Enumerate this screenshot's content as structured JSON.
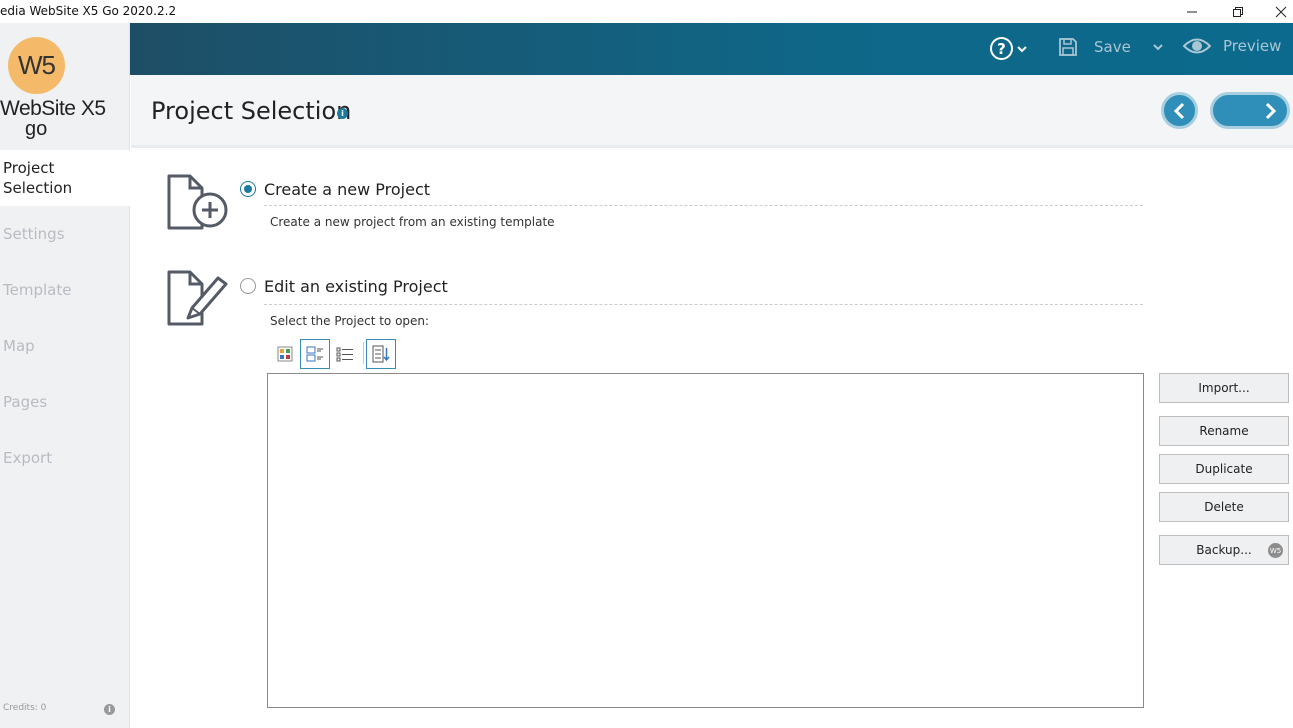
{
  "window": {
    "title": "edia WebSite X5 Go 2020.2.2"
  },
  "logo": {
    "mark": "W5",
    "name": "WebSite X5",
    "edition": "go"
  },
  "sidebar": {
    "items": [
      {
        "label": "Project Selection",
        "active": true
      },
      {
        "label": "Settings",
        "active": false
      },
      {
        "label": "Template",
        "active": false
      },
      {
        "label": "Map",
        "active": false
      },
      {
        "label": "Pages",
        "active": false
      },
      {
        "label": "Export",
        "active": false
      }
    ],
    "credits": "Credits: 0"
  },
  "toolbar": {
    "help_icon": "question-circle-icon",
    "save_label": "Save",
    "preview_label": "Preview"
  },
  "header": {
    "title": "Project Selection"
  },
  "main": {
    "create": {
      "label": "Create a new Project",
      "description": "Create a new project from an existing template",
      "selected": true
    },
    "edit": {
      "label": "Edit an existing Project",
      "prompt": "Select the Project to open:",
      "selected": false
    },
    "side_buttons": {
      "import": "Import...",
      "rename": "Rename",
      "duplicate": "Duplicate",
      "delete": "Delete",
      "backup": "Backup...",
      "backup_badge": "W5"
    }
  },
  "colors": {
    "accent": "#1a7aa0",
    "toolbar": "#0f6788",
    "logo": "#f5b96a"
  }
}
